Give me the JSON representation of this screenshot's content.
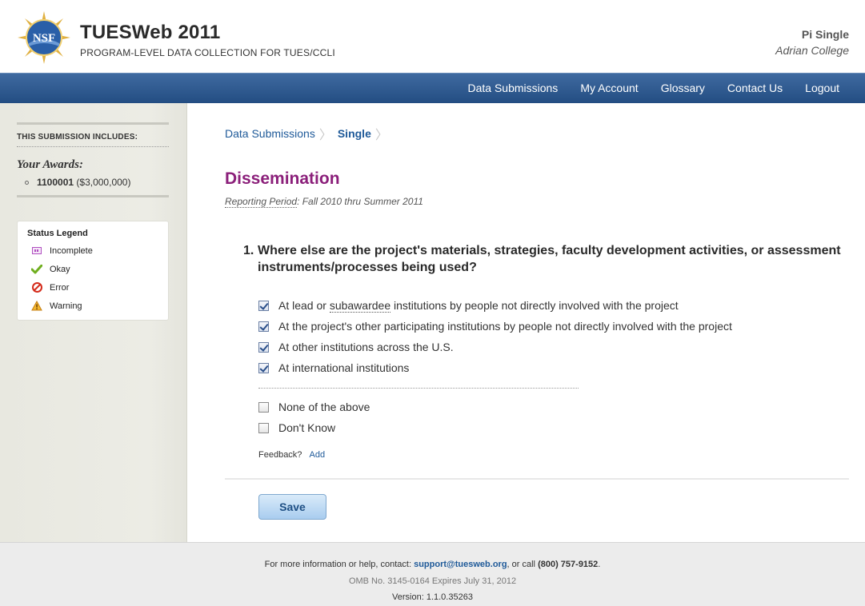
{
  "header": {
    "logo_text": "NSF",
    "title": "TUESWeb 2011",
    "subtitle": "PROGRAM-LEVEL DATA COLLECTION FOR TUES/CCLI",
    "user_name": "Pi Single",
    "user_org": "Adrian College"
  },
  "nav": {
    "items": [
      "Data Submissions",
      "My Account",
      "Glossary",
      "Contact Us",
      "Logout"
    ]
  },
  "sidebar": {
    "heading": "THIS SUBMISSION INCLUDES:",
    "awards_label": "Your Awards:",
    "award_id": "1100001",
    "award_amount": "($3,000,000)",
    "legend": {
      "title": "Status Legend",
      "items": [
        {
          "label": "Incomplete",
          "icon": "incomplete-icon"
        },
        {
          "label": "Okay",
          "icon": "check-icon"
        },
        {
          "label": "Error",
          "icon": "error-icon"
        },
        {
          "label": "Warning",
          "icon": "warning-icon"
        }
      ]
    }
  },
  "main": {
    "breadcrumb": [
      "Data Submissions",
      "Single"
    ],
    "title": "Dissemination",
    "period_label": "Reporting Period",
    "period_value": ": Fall 2010 thru Summer 2011",
    "question": {
      "number": "1.",
      "text": "Where else are the project's materials, strategies, faculty development activities, or assessment instruments/processes being used?"
    },
    "options": [
      {
        "label_pre": "At lead or ",
        "label_term": "subawardee",
        "label_post": " institutions by people not directly involved with the project",
        "checked": true
      },
      {
        "label": "At the project's other participating institutions by people not directly involved with the project",
        "checked": true
      },
      {
        "label": "At other institutions across the U.S.",
        "checked": true
      },
      {
        "label": "At international institutions",
        "checked": true
      },
      {
        "label": "None of the above",
        "checked": false
      },
      {
        "label": "Don't Know",
        "checked": false
      }
    ],
    "feedback_label": "Feedback?",
    "feedback_add": "Add",
    "save_label": "Save"
  },
  "footer": {
    "info_pre": "For more information or help, contact: ",
    "email": "support@tuesweb.org",
    "info_mid": ", or call ",
    "phone": "(800) 757-9152",
    "info_post": ".",
    "omb": "OMB No. 3145-0164 Expires July 31, 2012",
    "version": "Version: 1.1.0.35263"
  },
  "colors": {
    "nav_bg": "#2f5a8f",
    "title_purple": "#8b1f7a",
    "link_blue": "#1f5a99"
  }
}
